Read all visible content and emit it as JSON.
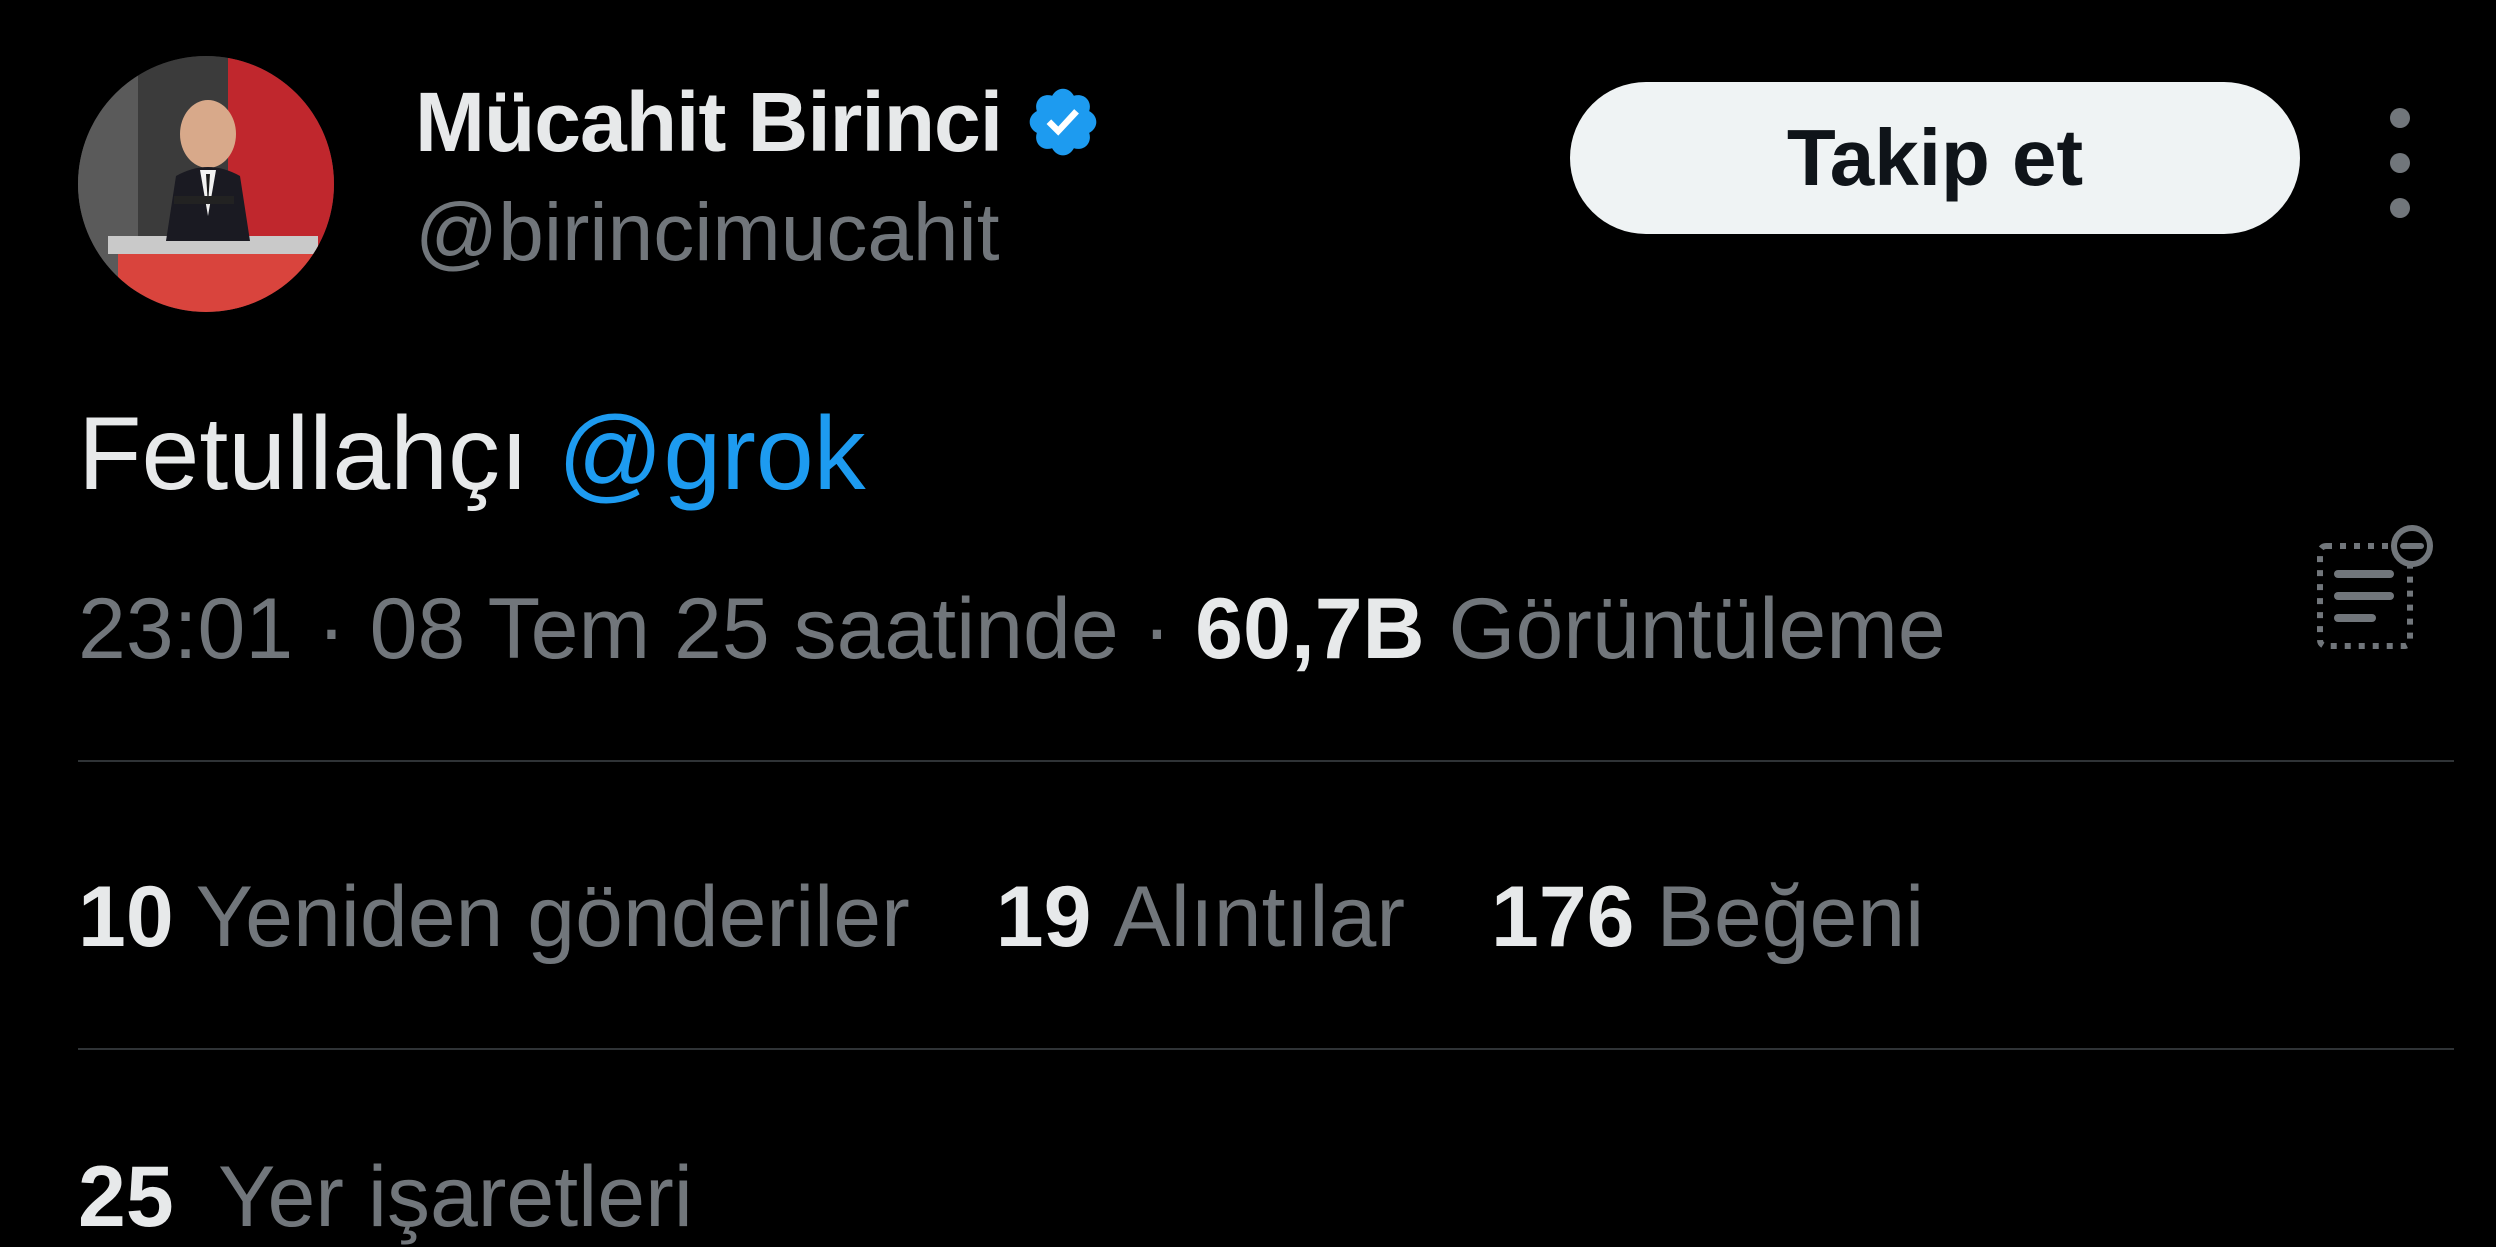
{
  "author": {
    "display_name": "Mücahit Birinci",
    "handle": "@birincimucahit",
    "verified_icon": "verified-badge-icon",
    "verified_color": "#1d9bf0"
  },
  "actions": {
    "follow_label": "Takip et",
    "more_icon": "more-vertical-icon"
  },
  "tweet": {
    "text_before": "Fetullahçı ",
    "mention": "@grok"
  },
  "meta": {
    "time": "23:01",
    "separator1": " · ",
    "date": "08 Tem 25 saatinde",
    "separator2": " · ",
    "views_count": "60,7B",
    "views_label": " Görüntüleme",
    "analytics_icon": "analytics-icon"
  },
  "stats": {
    "reposts_count": "10",
    "reposts_label": "Yeniden gönderiler",
    "quotes_count": "19",
    "quotes_label": "Alıntılar",
    "likes_count": "176",
    "likes_label": "Beğeni",
    "bookmarks_count": "25",
    "bookmarks_label": "Yer işaretleri"
  },
  "colors": {
    "background": "#000000",
    "text_primary": "#e7e9ea",
    "text_secondary": "#71767b",
    "accent": "#1d9bf0",
    "divider": "#2f3336",
    "button_bg": "#eff3f4"
  }
}
